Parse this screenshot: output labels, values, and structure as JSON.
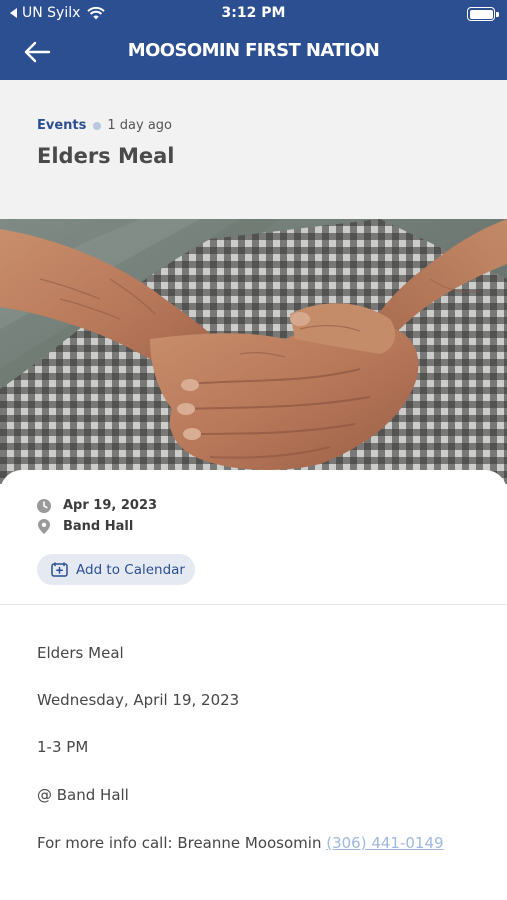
{
  "status_bar": {
    "carrier": "UN Syilx",
    "time": "3:12 PM"
  },
  "nav": {
    "title": "MOOSOMIN FIRST NATION",
    "back_icon": "arrow-left-icon"
  },
  "post": {
    "category": "Events",
    "posted_ago": "1 day ago",
    "title": "Elders Meal"
  },
  "event": {
    "date": "Apr 19, 2023",
    "location": "Band Hall",
    "add_to_calendar_label": "Add to Calendar"
  },
  "description": {
    "line1": "Elders Meal",
    "line2": "Wednesday, April 19, 2023",
    "line3": "1-3 PM",
    "line4": "@ Band Hall",
    "line5_prefix": "For more info call: Breanne Moosomin ",
    "phone": "(306) 441-0149"
  },
  "colors": {
    "brand_blue": "#2c4f92",
    "link": "#9fb8dc",
    "title_bg": "#f2f2f2"
  }
}
